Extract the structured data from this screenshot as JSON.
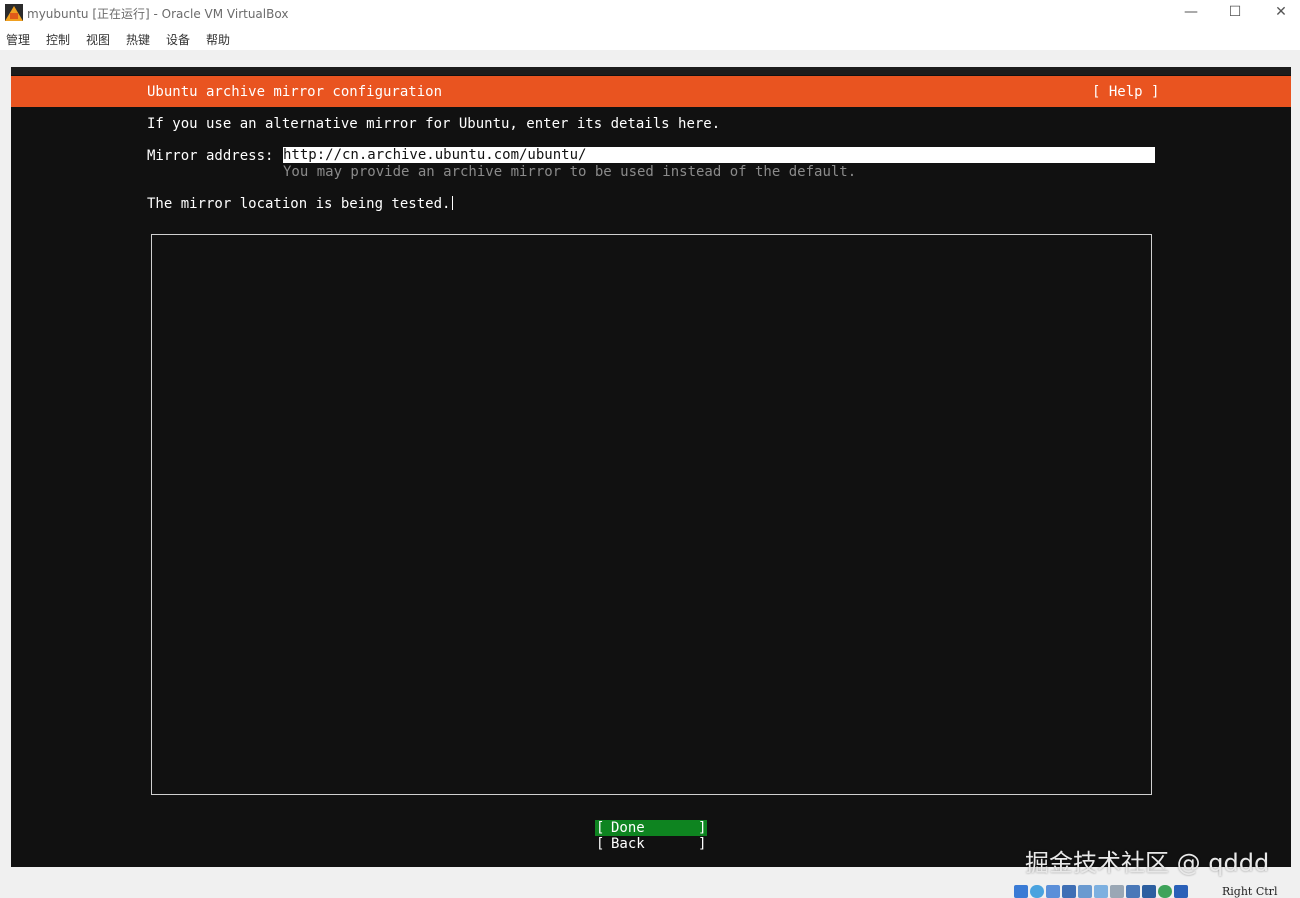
{
  "window": {
    "title": "myubuntu [正在运行] - Oracle VM VirtualBox",
    "controls": {
      "minimize": "—",
      "maximize": "☐",
      "close": "✕"
    }
  },
  "menu": [
    "管理",
    "控制",
    "视图",
    "热键",
    "设备",
    "帮助"
  ],
  "installer": {
    "header_title": "Ubuntu archive mirror configuration",
    "help_label": "[ Help ]",
    "intro": "If you use an alternative mirror for Ubuntu, enter its details here.",
    "mirror_label": "Mirror address:",
    "mirror_value": "http://cn.archive.ubuntu.com/ubuntu/",
    "mirror_hint": "You may provide an archive mirror to be used instead of the default.",
    "status": "The mirror location is being tested.",
    "buttons": {
      "done": "Done",
      "back": "Back",
      "left_bracket": "[",
      "right_bracket": "]"
    }
  },
  "watermark": "掘金技术社区 @ qddd",
  "statusbar": {
    "host_key": "Right Ctrl"
  },
  "colors": {
    "ubuntu_orange": "#e95420",
    "done_green": "#0e8420",
    "terminal_bg": "#111111"
  }
}
